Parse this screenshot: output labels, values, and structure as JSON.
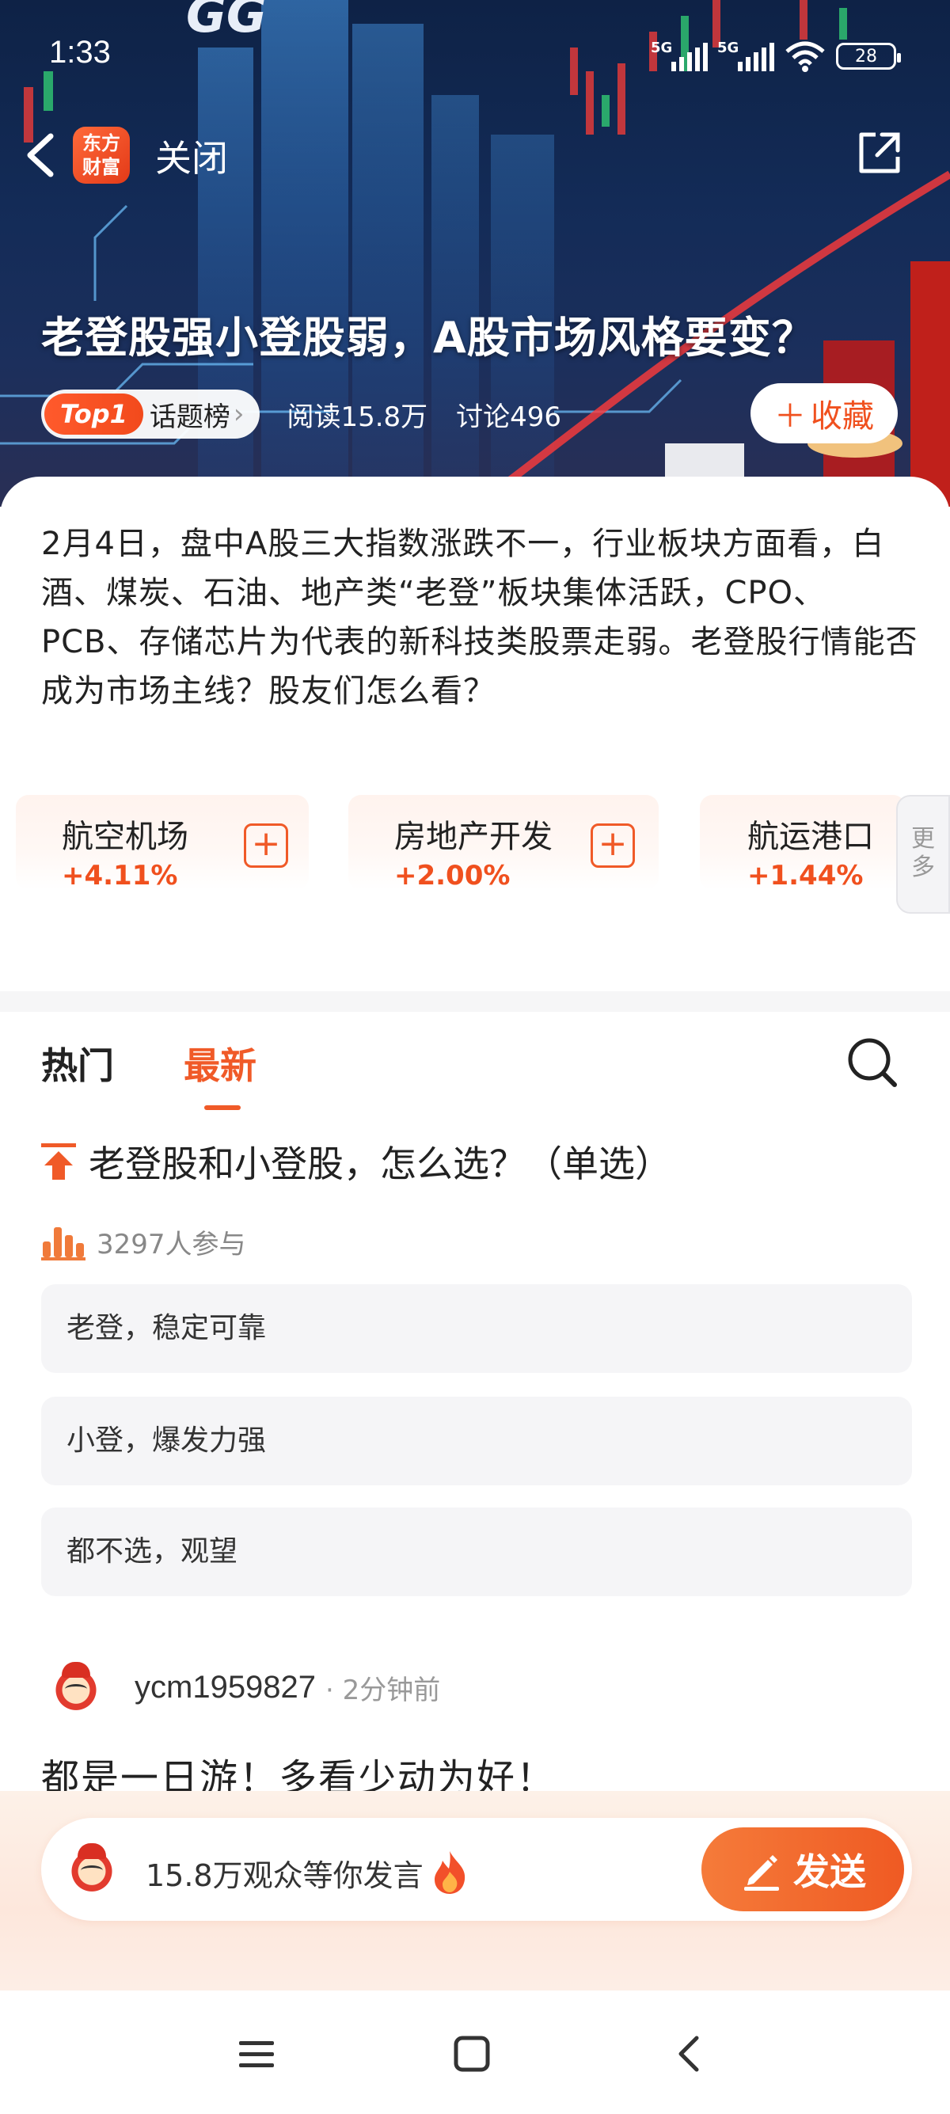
{
  "status_bar": {
    "time": "1:33",
    "network1": "5G",
    "network2": "5G",
    "battery": "28"
  },
  "nav": {
    "logo_line1": "东方",
    "logo_line2": "财富",
    "close_label": "关闭"
  },
  "topic": {
    "title": "老登股强小登股弱，A股市场风格要变？",
    "rank_badge": "Top1",
    "rank_label": "话题榜",
    "reads": "阅读15.8万",
    "discussions": "讨论496",
    "favorite_label": "收藏",
    "description": "2月4日，盘中A股三大指数涨跌不一，行业板块方面看，白酒、煤炭、石油、地产类“老登”板块集体活跃，CPO、PCB、存储芯片为代表的新科技类股票走弱。老登股行情能否成为市场主线？股友们怎么看？"
  },
  "sectors": [
    {
      "name": "航空机场",
      "change": "+4.11%"
    },
    {
      "name": "房地产开发",
      "change": "+2.00%"
    },
    {
      "name": "航运港口",
      "change": "+1.44%"
    }
  ],
  "more_label": "更多",
  "tabs": {
    "hot": "热门",
    "latest": "最新"
  },
  "poll": {
    "question": "老登股和小登股，怎么选？（单选）",
    "participants": "3297人参与",
    "options": [
      "老登，稳定可靠",
      "小登，爆发力强",
      "都不选，观望"
    ]
  },
  "comment": {
    "user": "ycm1959827",
    "time": "· 2分钟前",
    "text": "都是一日游！多看少动为好！"
  },
  "composer": {
    "placeholder": "15.8万观众等你发言",
    "send_label": "发送"
  },
  "colors": {
    "accent": "#f05a28",
    "rise": "#f0501e",
    "banner": "#132b57"
  }
}
